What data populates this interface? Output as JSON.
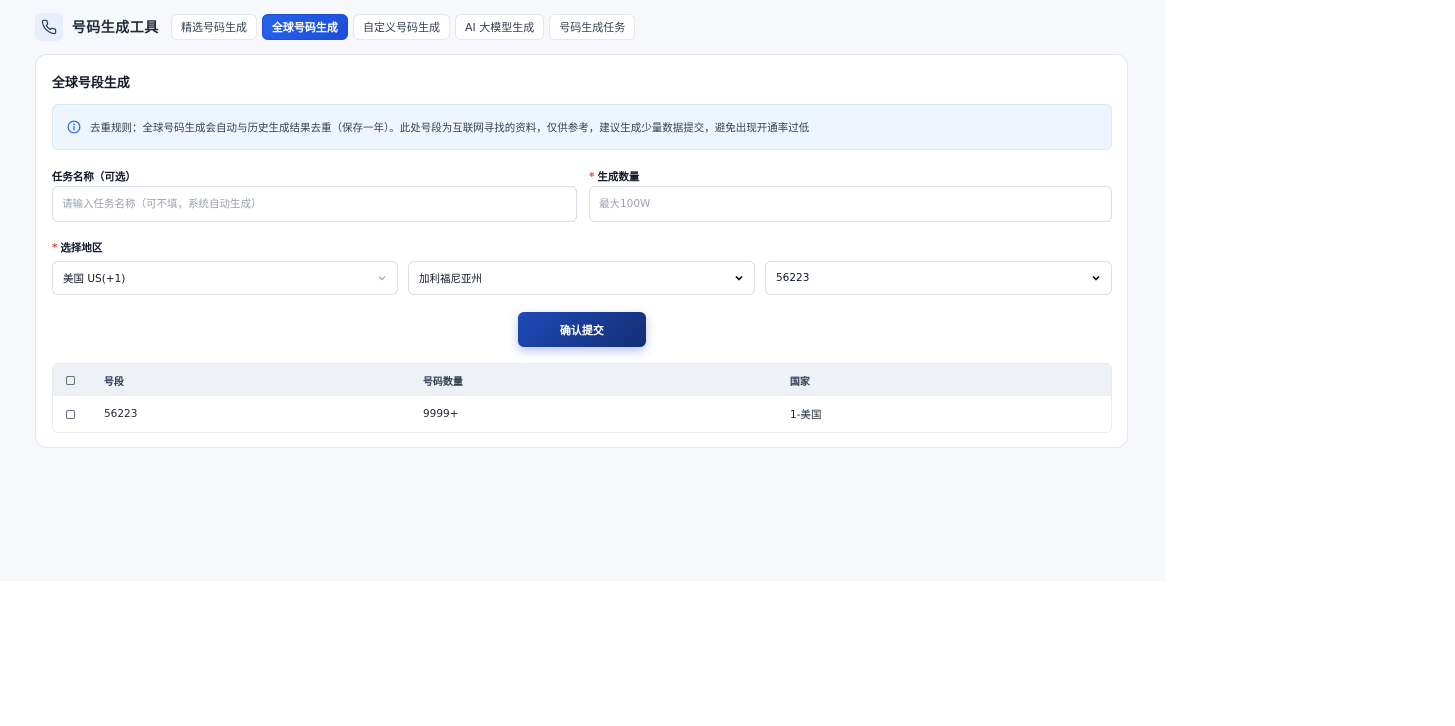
{
  "header": {
    "app_title": "号码生成工具",
    "tabs": [
      {
        "label": "精选号码生成",
        "active": false
      },
      {
        "label": "全球号码生成",
        "active": true
      },
      {
        "label": "自定义号码生成",
        "active": false
      },
      {
        "label": "AI 大模型生成",
        "active": false
      },
      {
        "label": "号码生成任务",
        "active": false
      }
    ]
  },
  "card": {
    "title": "全球号段生成",
    "notice": "去重规则：全球号码生成会自动与历史生成结果去重（保存一年）。此处号段为互联网寻找的资料，仅供参考，建议生成少量数据提交，避免出现开通率过低"
  },
  "form": {
    "task_name_label": "任务名称（可选）",
    "task_name_placeholder": "请输入任务名称（可不填，系统自动生成）",
    "task_name_value": "",
    "quantity_label": "生成数量",
    "quantity_required": "*",
    "quantity_placeholder": "最大100W",
    "quantity_value": "",
    "region_label": "选择地区",
    "region_required": "*",
    "country_value": "美国 US(+1)",
    "state_value": "加利福尼亚州",
    "segment_value": "56223",
    "submit_label": "确认提交"
  },
  "table": {
    "columns": [
      "号段",
      "号码数量",
      "国家"
    ],
    "rows": [
      {
        "segment": "56223",
        "count": "9999+",
        "country": "1-美国"
      }
    ]
  },
  "colors": {
    "accent": "#2563eb",
    "button_dark": "#132e72",
    "notice_bg": "#eff5fe",
    "required": "#ef4444"
  }
}
